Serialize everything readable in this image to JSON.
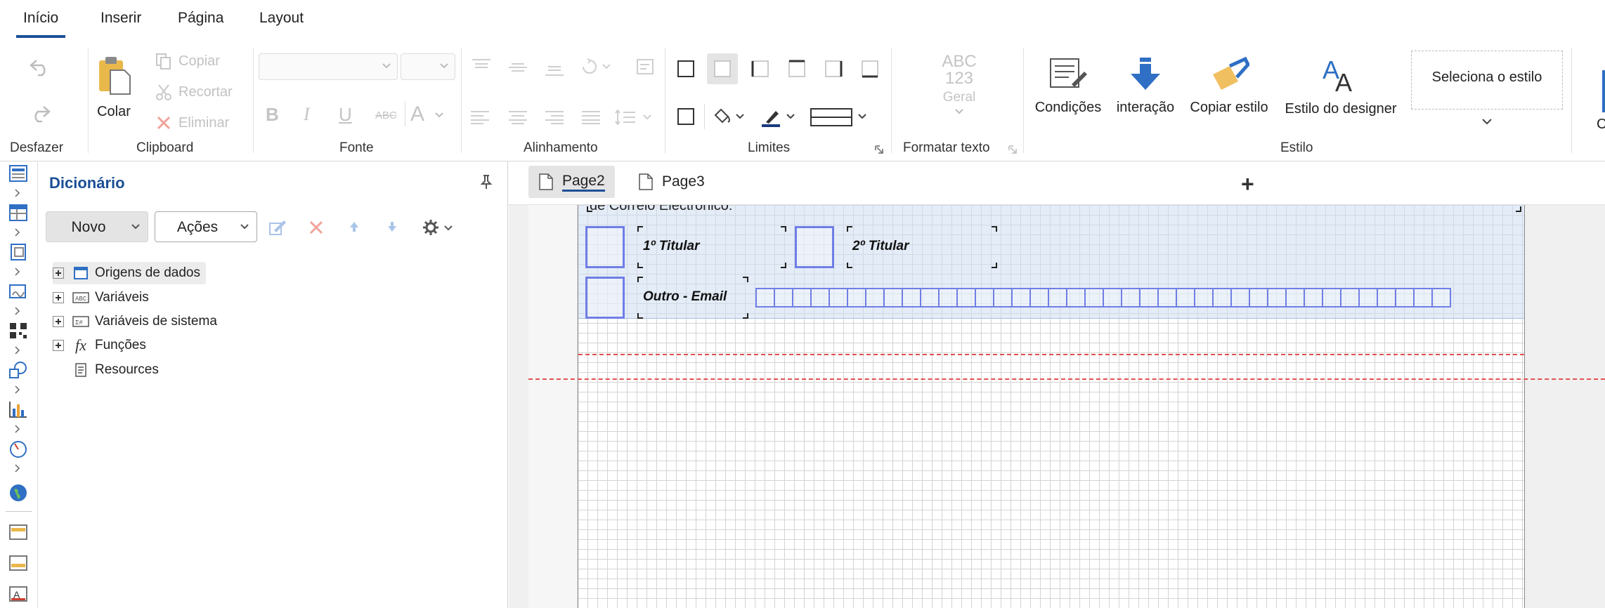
{
  "menu": {
    "tabs": [
      {
        "label": "Início",
        "active": true
      },
      {
        "label": "Inserir"
      },
      {
        "label": "Página"
      },
      {
        "label": "Layout"
      }
    ]
  },
  "ribbon": {
    "groups": {
      "undo": "Desfazer",
      "clipboard": "Clipboard",
      "font": "Fonte",
      "alignment": "Alinhamento",
      "borders": "Limites",
      "format": "Formatar texto",
      "style": "Estilo"
    },
    "clipboard": {
      "paste": "Colar",
      "copy": "Copiar",
      "cut": "Recortar",
      "delete": "Eliminar"
    },
    "format": {
      "preview_abc": "ABC",
      "preview_123": "123",
      "value": "Geral"
    },
    "style": {
      "conditions": "Condições",
      "interaction": "interação",
      "copy_style": "Copiar estilo",
      "designer_style": "Estilo do designer",
      "select_style": "Seleciona o estilo"
    },
    "cutoff_label": "C"
  },
  "dictionary": {
    "title": "Dicionário",
    "new_button": "Novo",
    "actions_button": "Ações",
    "tree": [
      {
        "label": "Origens de dados",
        "icon": "datasource-icon",
        "expandable": true,
        "selected": true
      },
      {
        "label": "Variáveis",
        "icon": "variables-icon",
        "expandable": true
      },
      {
        "label": "Variáveis de sistema",
        "icon": "system-variables-icon",
        "expandable": true
      },
      {
        "label": "Funções",
        "icon": "function-icon",
        "glyph": "fx",
        "expandable": true
      },
      {
        "label": "Resources",
        "icon": "resources-icon",
        "expandable": false
      }
    ]
  },
  "pages": {
    "tabs": [
      {
        "label": "Page2",
        "active": true
      },
      {
        "label": "Page3"
      }
    ],
    "add_label": "+"
  },
  "canvas": {
    "band_text": "de Correio Electrónico:",
    "label1": "1º Titular",
    "label2": "2º Titular",
    "label3": "Outro - Email",
    "email_cells": 38
  },
  "colors": {
    "accent": "#1c4f96",
    "checkbox_border": "#6f7ee6",
    "margin_line": "#e25151",
    "band_fill": "#cddcf0"
  }
}
